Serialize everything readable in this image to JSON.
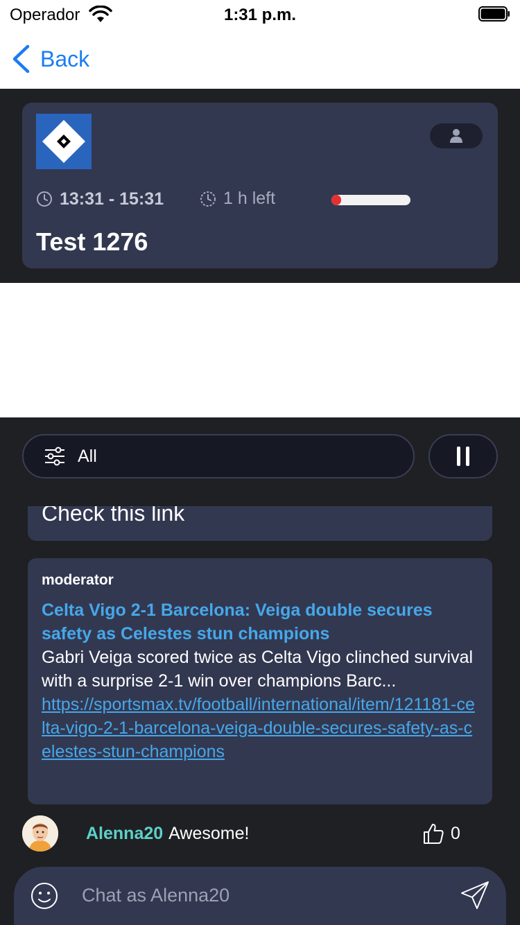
{
  "status_bar": {
    "carrier": "Operador",
    "time": "1:31 p.m."
  },
  "nav": {
    "back_label": "Back"
  },
  "event": {
    "time_range": "13:31 - 15:31",
    "time_left": "1 h left",
    "progress_fraction": 0.12,
    "title": "Test 1276",
    "progress_color": "#e53030"
  },
  "chat": {
    "filter_label": "All",
    "partial_message": "Check this link",
    "moderator_message": {
      "author": "moderator",
      "headline": "Celta Vigo 2-1 Barcelona: Veiga double secures safety as Celestes stun champions",
      "body": "Gabri Veiga scored twice as Celta Vigo clinched survival with a surprise 2-1 win over champions Barc...",
      "link": "https://sportsmax.tv/football/international/item/121181-celta-vigo-2-1-barcelona-veiga-double-secures-safety-as-celestes-stun-champions"
    },
    "last_message": {
      "username": "Alenna20",
      "text": "Awesome!",
      "likes": "0"
    },
    "input_placeholder": "Chat as Alenna20"
  },
  "colors": {
    "accent_blue": "#1a7cf5",
    "link_blue": "#45a8ea",
    "username_teal": "#5dd0c9",
    "card_bg": "#333851",
    "panel_bg": "#1f2023"
  },
  "icons": {
    "wifi": "wifi-icon",
    "battery": "battery-icon",
    "back": "chevron-left-icon",
    "clock": "clock-icon",
    "user": "user-icon",
    "filter": "sliders-icon",
    "pause": "pause-icon",
    "like": "thumbs-up-icon",
    "emoji": "smiley-icon",
    "send": "paper-plane-icon"
  }
}
